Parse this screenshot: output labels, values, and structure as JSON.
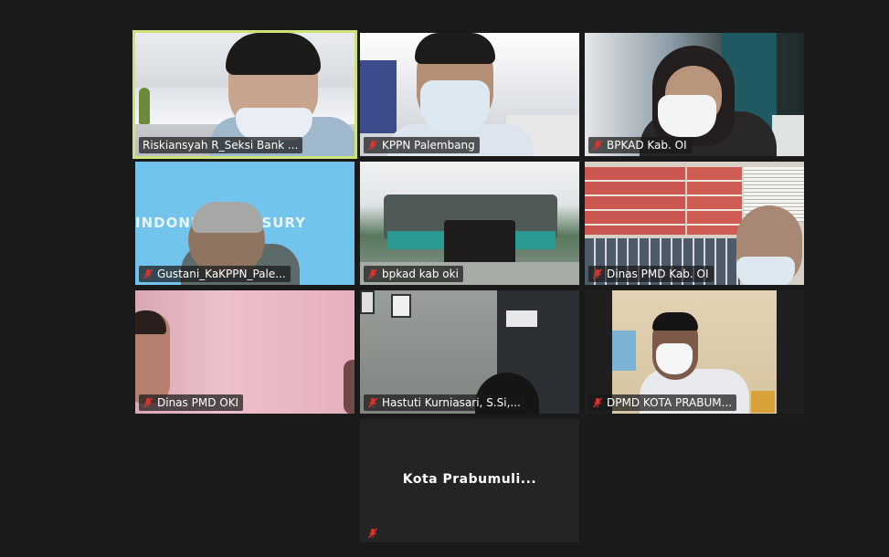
{
  "participants": [
    {
      "name": "Riskiansyah R_Seksi Bank ...",
      "muted": false,
      "active_speaker": true,
      "background": "#c8ccd0"
    },
    {
      "name": "KPPN Palembang",
      "muted": true,
      "active_speaker": false,
      "background": "#d9dde2"
    },
    {
      "name": "BPKAD Kab. OI",
      "muted": true,
      "active_speaker": false,
      "background": "#2f3a3a"
    },
    {
      "name": "Gustani_KaKPPN_Pale...",
      "muted": true,
      "active_speaker": false,
      "background": "#6fc2ea",
      "virtual_background_text": "INDONE   TREASURY"
    },
    {
      "name": "bpkad kab oki",
      "muted": true,
      "active_speaker": false,
      "background": "#b8c6cc"
    },
    {
      "name": "Dinas PMD Kab. OI",
      "muted": true,
      "active_speaker": false,
      "background": "#d8d2c8"
    },
    {
      "name": "Dinas PMD OKI",
      "muted": true,
      "active_speaker": false,
      "background": "#e5b5c0"
    },
    {
      "name": "Hastuti Kurniasari, S.Si,...",
      "muted": true,
      "active_speaker": false,
      "background": "#8a8f8a"
    },
    {
      "name": "DPMD KOTA PRABUM...",
      "muted": true,
      "active_speaker": false,
      "background": "#1f1f1f"
    },
    {
      "name": "",
      "muted": true,
      "active_speaker": false,
      "background": "#242424",
      "center_label": "Kota  Prabumuli..."
    }
  ],
  "colors": {
    "app_background": "#1a1a1a",
    "active_speaker_border": "#cde37a",
    "muted_icon": "#e0332d"
  }
}
